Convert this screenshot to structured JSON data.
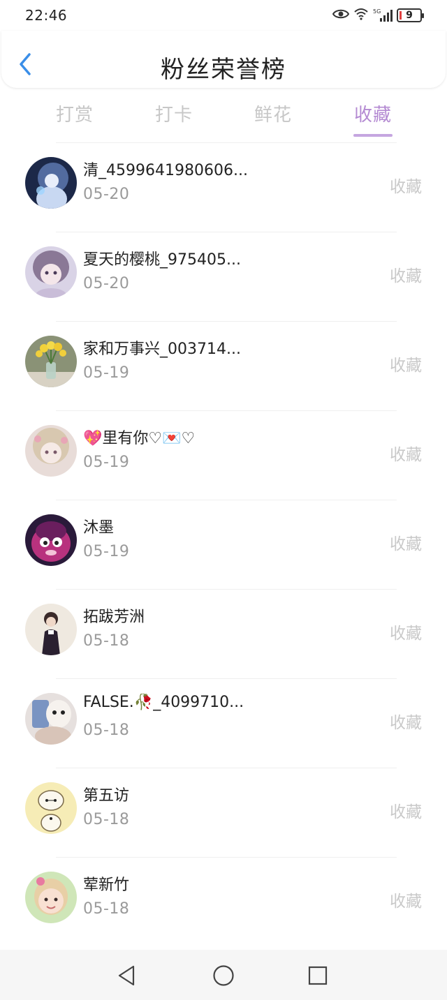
{
  "status_bar": {
    "time": "22:46",
    "network": "5G",
    "battery": "9",
    "icons": [
      "eye-icon",
      "wifi-icon",
      "signal-icon",
      "battery-icon"
    ]
  },
  "header": {
    "title": "粉丝荣誉榜",
    "back_icon": "chevron-left-icon",
    "accent_color": "#3a8ee8"
  },
  "tabs": [
    {
      "label": "打赏",
      "active": false
    },
    {
      "label": "打卡",
      "active": false
    },
    {
      "label": "鲜花",
      "active": false
    },
    {
      "label": "收藏",
      "active": true
    }
  ],
  "colors": {
    "active_tab": "#b48ad2",
    "inactive_tab": "#c7c7c7",
    "date": "#9a9a9a",
    "action": "#c9c9c9"
  },
  "fans": [
    {
      "name": "清_4599641980606...",
      "date": "05-20",
      "action": "收藏"
    },
    {
      "name": "夏天的樱桃_975405...",
      "date": "05-20",
      "action": "收藏"
    },
    {
      "name": "家和万事兴_003714...",
      "date": "05-19",
      "action": "收藏"
    },
    {
      "name": "💖里有你♡💌♡",
      "date": "05-19",
      "action": "收藏"
    },
    {
      "name": "沐墨",
      "date": "05-19",
      "action": "收藏"
    },
    {
      "name": "拓跋芳洲",
      "date": "05-18",
      "action": "收藏"
    },
    {
      "name": "FALSE.🥀_4099710...",
      "date": "05-18",
      "action": "收藏"
    },
    {
      "name": "第五访",
      "date": "05-18",
      "action": "收藏"
    },
    {
      "name": "荤新竹",
      "date": "05-18",
      "action": "收藏"
    }
  ],
  "nav_bar": {
    "icons": [
      "back-triangle-icon",
      "home-circle-icon",
      "recents-square-icon"
    ]
  }
}
